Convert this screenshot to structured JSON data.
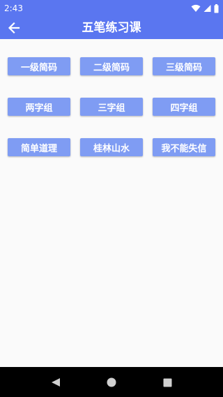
{
  "status_bar": {
    "time": "2:43",
    "icons": [
      "wifi-icon",
      "signal-icon",
      "battery-icon"
    ]
  },
  "app_bar": {
    "title": "五笔练习课",
    "back_icon": "arrow-left-icon",
    "color": "#5a76f0"
  },
  "lessons": {
    "button_color": "#7f9cf3",
    "items": [
      {
        "label": "一级简码"
      },
      {
        "label": "二级简码"
      },
      {
        "label": "三级简码"
      },
      {
        "label": "两字组"
      },
      {
        "label": "三字组"
      },
      {
        "label": "四字组"
      },
      {
        "label": "简单道理"
      },
      {
        "label": "桂林山水"
      },
      {
        "label": "我不能失信"
      }
    ]
  },
  "nav_bar": {
    "icons": [
      "back-triangle-icon",
      "home-circle-icon",
      "recents-square-icon"
    ]
  }
}
